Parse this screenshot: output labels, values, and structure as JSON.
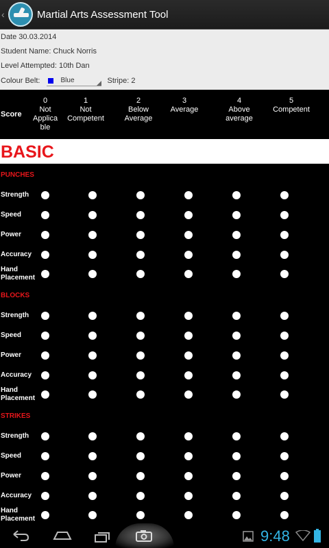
{
  "app": {
    "title": "Martial Arts Assessment Tool",
    "up_caret": "‹"
  },
  "info": {
    "date": "Date 30.03.2014",
    "student": "Student Name: Chuck Norris",
    "level": "Level Attempted: 10th Dan",
    "belt_label": "Colour Belt:",
    "belt_value": "Blue",
    "belt_color": "#0000ee",
    "stripe": "Stripe: 2"
  },
  "score_header": {
    "label": "Score",
    "columns": [
      {
        "num": "0",
        "text": "Not Applica ble"
      },
      {
        "num": "1",
        "text": "Not Competent"
      },
      {
        "num": "2",
        "text": "Below Average"
      },
      {
        "num": "3",
        "text": "Average"
      },
      {
        "num": "4",
        "text": "Above average"
      },
      {
        "num": "5",
        "text": "Competent"
      }
    ]
  },
  "section": {
    "title": "BASIC",
    "color": "#e8161b"
  },
  "groups": [
    {
      "title": "PUNCHES",
      "criteria": [
        "Strength",
        "Speed",
        "Power",
        "Accuracy",
        "Hand Placement"
      ]
    },
    {
      "title": "BLOCKS",
      "criteria": [
        "Strength",
        "Speed",
        "Power",
        "Accuracy",
        "Hand Placement"
      ]
    },
    {
      "title": "STRIKES",
      "criteria": [
        "Strength",
        "Speed",
        "Power",
        "Accuracy",
        "Hand Placement"
      ]
    }
  ],
  "status": {
    "time": "9:48",
    "accent": "#33b5e5"
  }
}
